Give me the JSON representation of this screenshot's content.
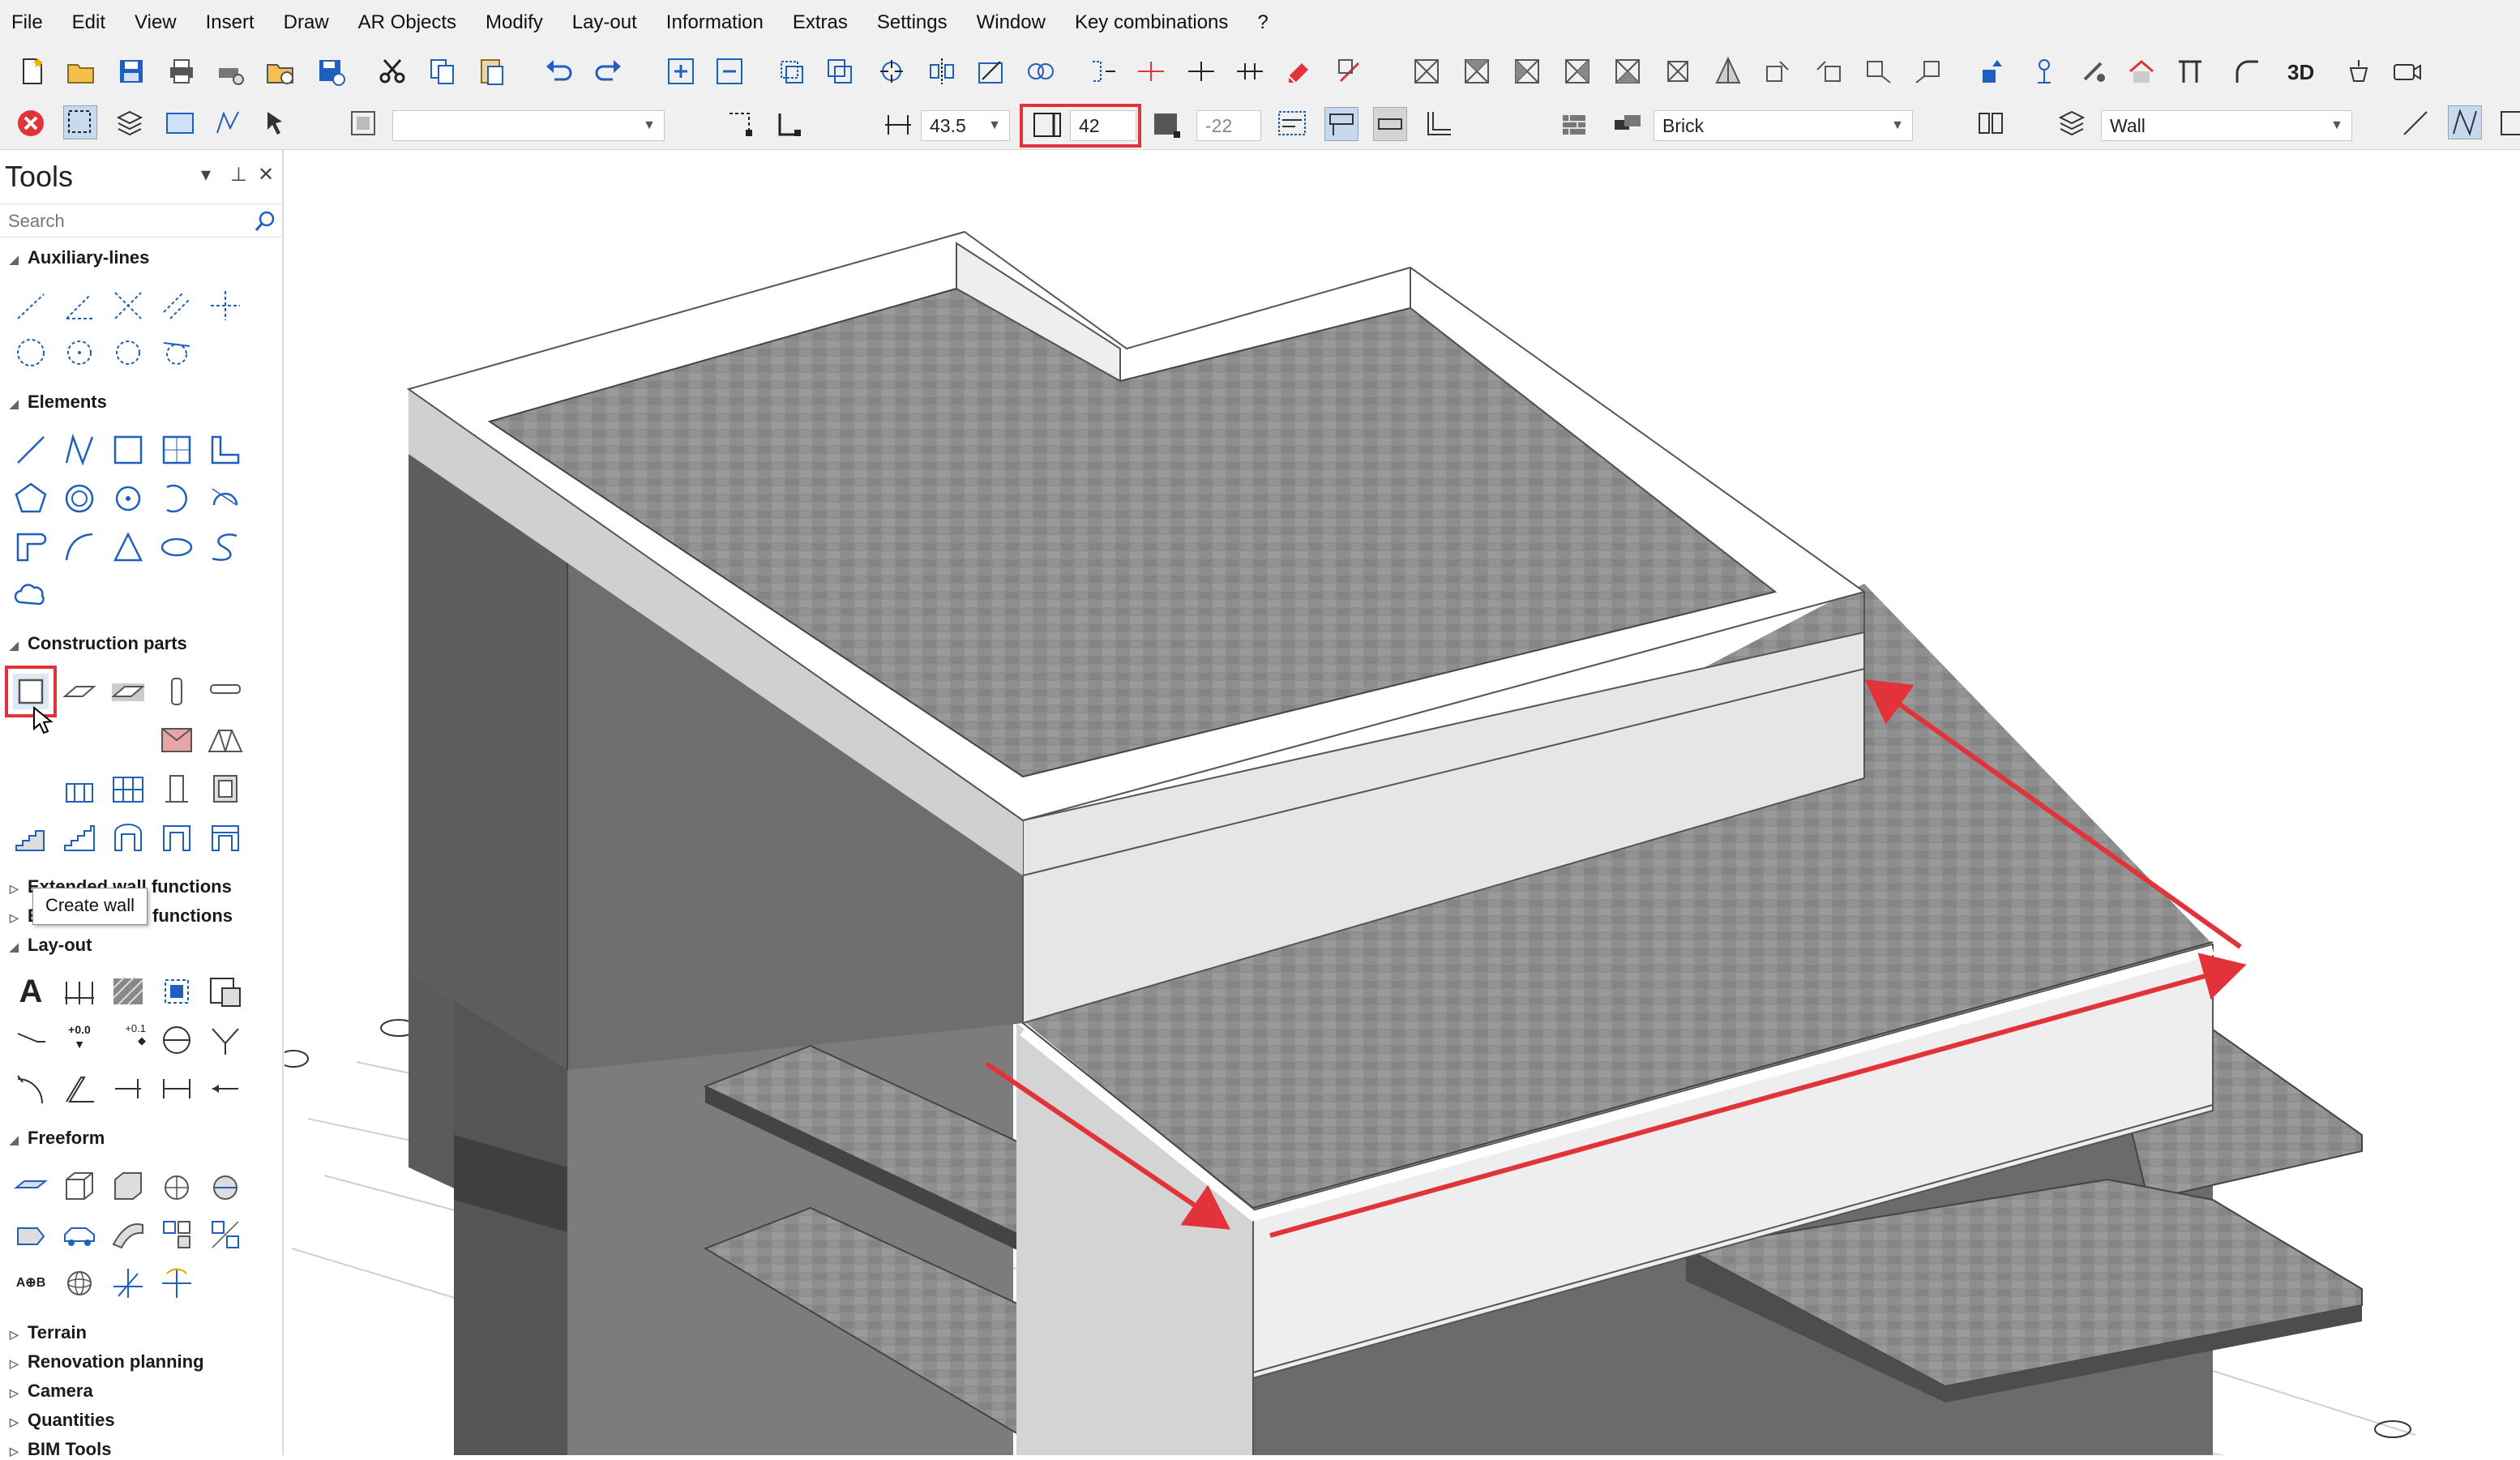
{
  "menu": [
    "File",
    "Edit",
    "View",
    "Insert",
    "Draw",
    "AR Objects",
    "Modify",
    "Lay-out",
    "Information",
    "Extras",
    "Settings",
    "Window",
    "Key combinations",
    "?"
  ],
  "toolbar2": {
    "layer_value": "",
    "thickness": "43.5",
    "height": "42",
    "offset": "-22",
    "material": "Brick",
    "element_type": "Wall",
    "view_3d_label": "3D"
  },
  "tools_panel": {
    "title": "Tools",
    "search_placeholder": "Search",
    "sections": {
      "auxiliary": "Auxiliary-lines",
      "elements": "Elements",
      "construction": "Construction parts",
      "ext_wall": "Extended wall functions",
      "ext_roof": "Extended roof functions",
      "layout": "Lay-out",
      "freeform": "Freeform",
      "terrain": "Terrain",
      "renovation": "Renovation planning",
      "camera": "Camera",
      "quantities": "Quantities",
      "bim": "BIM Tools"
    },
    "tooltip": "Create wall",
    "layout_labels": {
      "text_tool": "A",
      "level_plus": "+0.0",
      "level_small": "+0.1",
      "gen_text": "A⊕B"
    }
  },
  "colors": {
    "accent_red": "#e2333a",
    "toolbar_bg": "#f0f0f0",
    "icon_blue": "#1f5fbf"
  }
}
